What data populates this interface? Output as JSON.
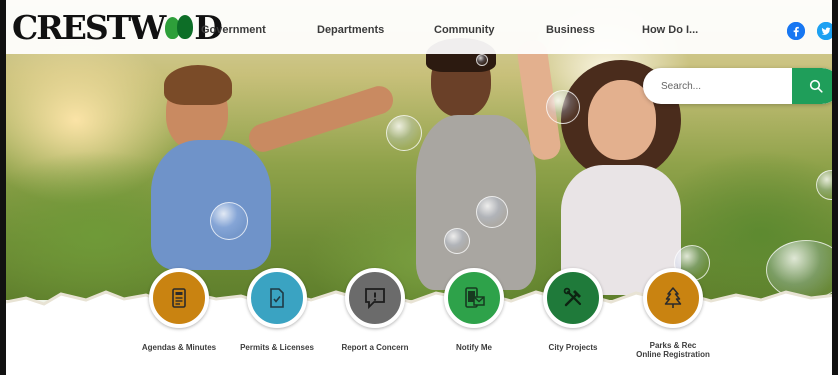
{
  "header": {
    "logo_text_left": "CRESTW",
    "logo_text_right": "D",
    "nav": [
      {
        "label": "Government"
      },
      {
        "label": "Departments"
      },
      {
        "label": "Community"
      },
      {
        "label": "Business"
      },
      {
        "label": "How Do I..."
      }
    ],
    "social": [
      {
        "icon": "facebook-icon",
        "glyph": "f",
        "color": "#1877f2"
      },
      {
        "icon": "twitter-icon",
        "glyph": "t",
        "color": "#1da1f2"
      }
    ]
  },
  "search": {
    "placeholder": "Search...",
    "button_color": "#1f9e5a"
  },
  "quick_links": [
    {
      "label": "Agendas & Minutes",
      "icon": "document-icon",
      "color": "#c98311"
    },
    {
      "label": "Permits & Licenses",
      "icon": "checklist-icon",
      "color": "#3aa3c2"
    },
    {
      "label": "Report a Concern",
      "icon": "speech-bubble-alert-icon",
      "color": "#6b6b6b"
    },
    {
      "label": "Notify Me",
      "icon": "phone-mail-icon",
      "color": "#2ea24a"
    },
    {
      "label": "City Projects",
      "icon": "tools-icon",
      "color": "#1f7a3a"
    },
    {
      "label_line1": "Parks & Rec",
      "label_line2": "Online Registration",
      "icon": "tree-icon",
      "color": "#c98311"
    }
  ]
}
